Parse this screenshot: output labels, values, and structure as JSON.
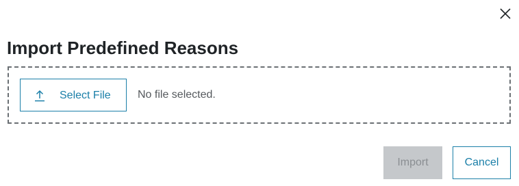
{
  "dialog": {
    "title": "Import Predefined Reasons",
    "close_icon": "close-icon"
  },
  "upload": {
    "button_label": "Select File",
    "button_icon": "upload-icon",
    "status_text": "No file selected."
  },
  "footer": {
    "import_label": "Import",
    "import_enabled": false,
    "cancel_label": "Cancel"
  },
  "colors": {
    "accent": "#1a7fa8",
    "title_text": "#1f2326",
    "muted_text": "#55595d",
    "disabled_bg": "#c5c8cb",
    "disabled_text": "#8a8e92",
    "dashed_border": "#6a6f73"
  }
}
